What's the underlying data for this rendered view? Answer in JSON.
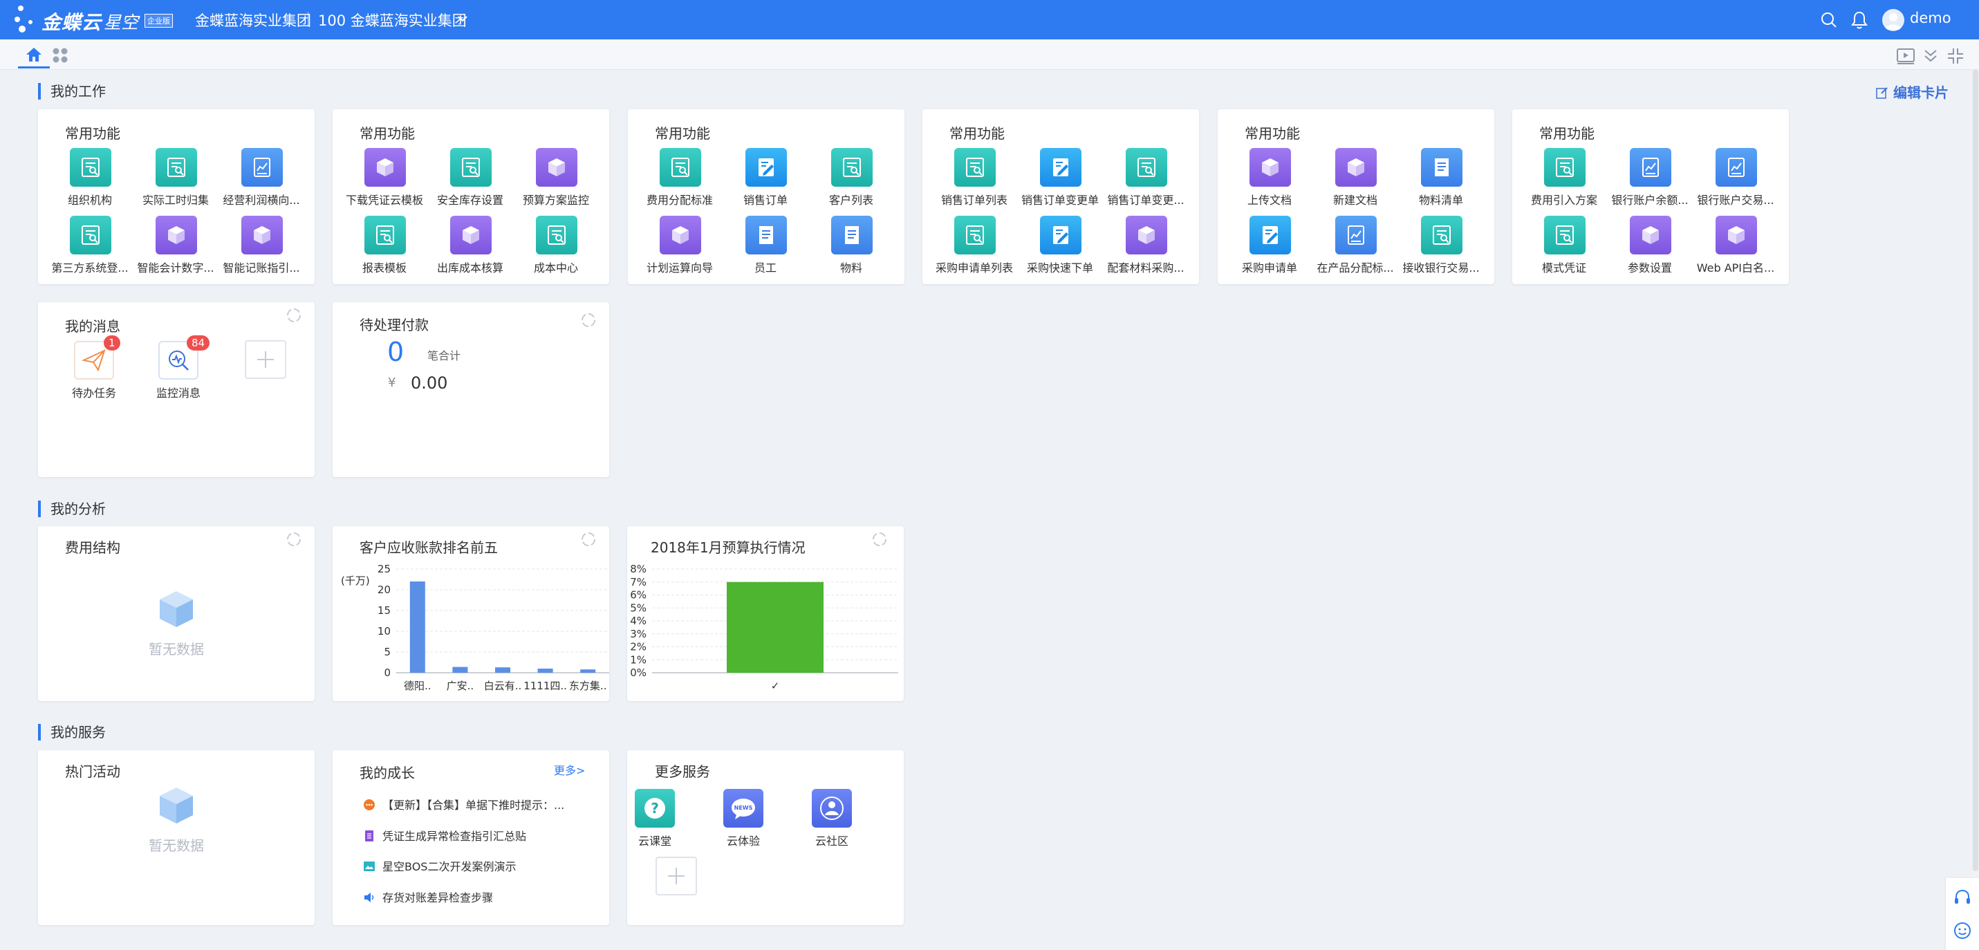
{
  "topbar": {
    "logo_text": "金蝶云",
    "logo_sub": "星空",
    "logo_badge": "企业版",
    "org_name": "金蝶蓝海实业集团",
    "org_unit": "100 金蝶蓝海实业集团",
    "user": "demo",
    "colors": {
      "bar": "#2e7af0"
    }
  },
  "sections": {
    "work": "我的工作",
    "analysis": "我的分析",
    "service": "我的服务",
    "edit_card": "编辑卡片"
  },
  "work_cards": [
    {
      "title": "常用功能",
      "items": [
        {
          "label": "组织机构",
          "icon": "report-teal"
        },
        {
          "label": "实际工时归集",
          "icon": "report-teal"
        },
        {
          "label": "经营利润横向...",
          "icon": "chart-blue"
        },
        {
          "label": "第三方系统登...",
          "icon": "report-teal"
        },
        {
          "label": "智能会计数字...",
          "icon": "cube-purple"
        },
        {
          "label": "智能记账指引...",
          "icon": "cube-purple"
        }
      ]
    },
    {
      "title": "常用功能",
      "items": [
        {
          "label": "下载凭证云模板",
          "icon": "cube-purple"
        },
        {
          "label": "安全库存设置",
          "icon": "report-teal"
        },
        {
          "label": "预算方案监控",
          "icon": "cube-purple"
        },
        {
          "label": "报表模板",
          "icon": "report-teal"
        },
        {
          "label": "出库成本核算",
          "icon": "cube-purple"
        },
        {
          "label": "成本中心",
          "icon": "report-teal"
        }
      ]
    },
    {
      "title": "常用功能",
      "items": [
        {
          "label": "费用分配标准",
          "icon": "report-teal"
        },
        {
          "label": "销售订单",
          "icon": "edit-cyan"
        },
        {
          "label": "客户列表",
          "icon": "report-teal"
        },
        {
          "label": "计划运算向导",
          "icon": "cube-purple"
        },
        {
          "label": "员工",
          "icon": "doc-blue"
        },
        {
          "label": "物料",
          "icon": "doc-blue"
        }
      ]
    },
    {
      "title": "常用功能",
      "items": [
        {
          "label": "销售订单列表",
          "icon": "report-teal"
        },
        {
          "label": "销售订单变更单",
          "icon": "edit-cyan"
        },
        {
          "label": "销售订单变更...",
          "icon": "report-teal"
        },
        {
          "label": "采购申请单列表",
          "icon": "report-teal"
        },
        {
          "label": "采购快速下单",
          "icon": "edit-cyan"
        },
        {
          "label": "配套材料采购...",
          "icon": "cube-purple"
        }
      ]
    },
    {
      "title": "常用功能",
      "items": [
        {
          "label": "上传文档",
          "icon": "cube-purple"
        },
        {
          "label": "新建文档",
          "icon": "cube-purple"
        },
        {
          "label": "物料清单",
          "icon": "doc-blue"
        },
        {
          "label": "采购申请单",
          "icon": "edit-cyan"
        },
        {
          "label": "在产品分配标...",
          "icon": "chart-blue"
        },
        {
          "label": "接收银行交易...",
          "icon": "report-teal"
        }
      ]
    },
    {
      "title": "常用功能",
      "items": [
        {
          "label": "费用引入方案",
          "icon": "report-teal"
        },
        {
          "label": "银行账户余额...",
          "icon": "chart-blue"
        },
        {
          "label": "银行账户交易...",
          "icon": "chart-blue"
        },
        {
          "label": "模式凭证",
          "icon": "report-teal"
        },
        {
          "label": "参数设置",
          "icon": "cube-purple"
        },
        {
          "label": "Web API白名...",
          "icon": "cube-purple"
        }
      ]
    }
  ],
  "messages": {
    "title": "我的消息",
    "items": [
      {
        "label": "待办任务",
        "badge": "1",
        "icon": "paper-plane-icon"
      },
      {
        "label": "监控消息",
        "badge": "84",
        "icon": "monitor-search-icon"
      }
    ]
  },
  "payment": {
    "title": "待处理付款",
    "count": "0",
    "count_unit": "笔合计",
    "currency": "¥",
    "amount": "0.00"
  },
  "analysis": {
    "cost_structure": {
      "title": "费用结构",
      "empty": "暂无数据"
    },
    "receivable": {
      "title": "客户应收账款排名前五"
    },
    "budget": {
      "title": "2018年1月预算执行情况"
    }
  },
  "chart_data": [
    {
      "type": "bar",
      "title": "客户应收账款排名前五",
      "ylabel": "(千万)",
      "categories": [
        "德阳..",
        "广安..",
        "白云有..",
        "1111四..",
        "东方集.."
      ],
      "values": [
        22.0,
        1.4,
        1.3,
        1.0,
        0.8
      ],
      "ylim": [
        0,
        25
      ],
      "yticks": [
        "0",
        "5",
        "10",
        "15",
        "20",
        "25"
      ],
      "grid": true,
      "color": "#5b8fe6"
    },
    {
      "type": "bar",
      "title": "2018年1月预算执行情况",
      "categories": [
        "✓"
      ],
      "values": [
        7.0
      ],
      "ylim": [
        0,
        8
      ],
      "yticks": [
        "0%",
        "1%",
        "2%",
        "3%",
        "4%",
        "5%",
        "6%",
        "7%",
        "8%"
      ],
      "grid": true,
      "color": "#4db530"
    }
  ],
  "services": {
    "hot": {
      "title": "热门活动",
      "empty": "暂无数据"
    },
    "growth": {
      "title": "我的成长",
      "more": "更多>",
      "items": [
        {
          "text": "【更新】【合集】单据下推时提示：...",
          "icon": "chat-orange-icon"
        },
        {
          "text": "凭证生成异常检查指引汇总贴",
          "icon": "doc-purple-icon"
        },
        {
          "text": "星空BOS二次开发案例演示",
          "icon": "image-teal-icon"
        },
        {
          "text": "存货对账差异检查步骤",
          "icon": "speaker-blue-icon"
        }
      ]
    },
    "more": {
      "title": "更多服务",
      "items": [
        {
          "label": "云课堂",
          "icon": "question-icon"
        },
        {
          "label": "云体验",
          "icon": "news-icon"
        },
        {
          "label": "云社区",
          "icon": "community-icon"
        }
      ]
    }
  }
}
